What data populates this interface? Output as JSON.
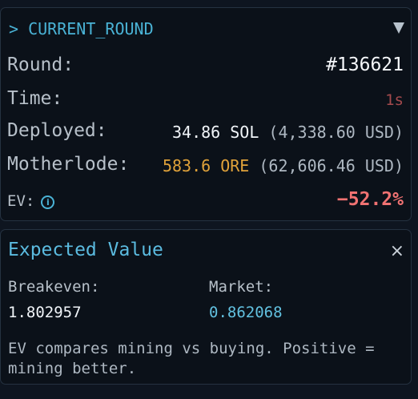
{
  "current_round": {
    "header": "> CURRENT_ROUND",
    "collapse_icon": "triangle-down-icon",
    "round_label": "Round:",
    "round_value": "#136621",
    "time_label": "Time:",
    "time_value": "1s",
    "deployed_label": "Deployed:",
    "deployed_sol": "34.86 SOL",
    "deployed_usd": "(4,338.60 USD)",
    "motherlode_label": "Motherlode:",
    "motherlode_ore": "583.6 ORE",
    "motherlode_usd": "(62,606.46 USD)",
    "ev_label": "EV:",
    "ev_info_icon": "i",
    "ev_value": "−52.2%"
  },
  "expected_value": {
    "title": "Expected Value",
    "close_icon": "×",
    "breakeven_label": "Breakeven:",
    "breakeven_value": "1.802957",
    "market_label": "Market:",
    "market_value": "0.862068",
    "description": "EV compares mining vs buying. Positive = mining better."
  },
  "colors": {
    "accent": "#4ab3d6",
    "ore": "#e0a23a",
    "negative": "#f07272",
    "background": "#0b1119"
  }
}
